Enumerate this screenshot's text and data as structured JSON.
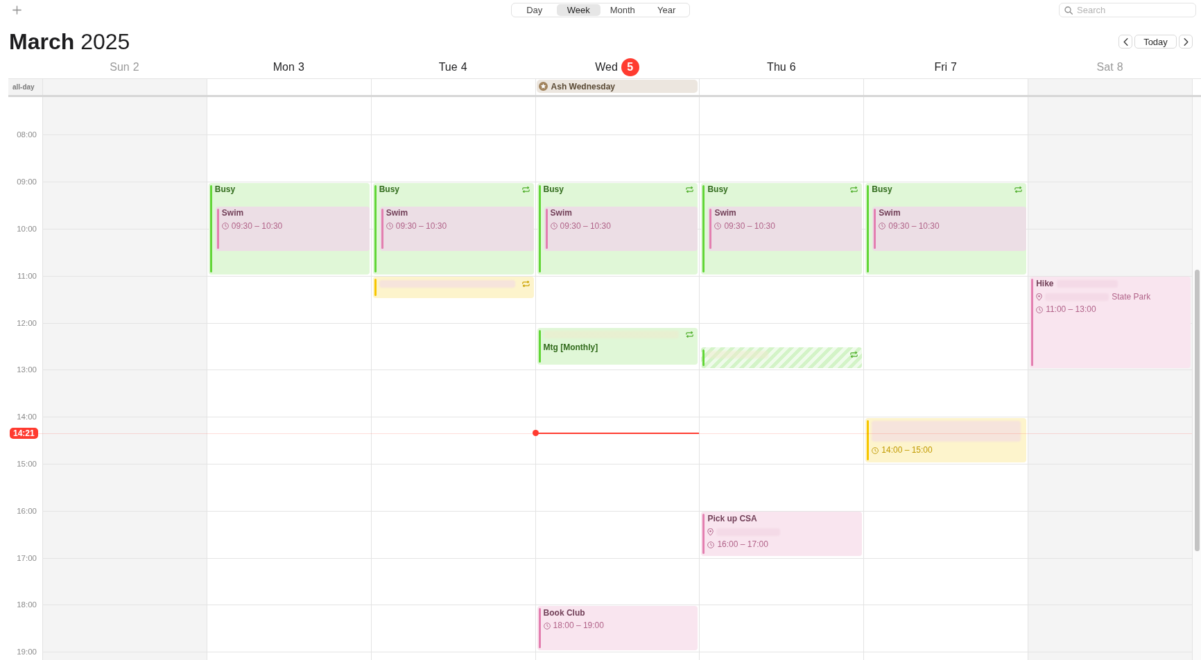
{
  "toolbar": {
    "views": [
      {
        "label": "Day",
        "selected": false
      },
      {
        "label": "Week",
        "selected": true
      },
      {
        "label": "Month",
        "selected": false
      },
      {
        "label": "Year",
        "selected": false
      }
    ],
    "search": {
      "placeholder": "Search"
    }
  },
  "header": {
    "title": "**March** 2025",
    "today_button": "Today"
  },
  "all_day_label": "all-day",
  "hours": [
    "08:00",
    "09:00",
    "10:00",
    "11:00",
    "12:00",
    "13:00",
    "14:00",
    "15:00",
    "16:00",
    "17:00",
    "18:00",
    "19:00"
  ],
  "now": {
    "label": "14:21"
  },
  "days": [
    {
      "weekday": "Sun",
      "date": "2",
      "weekend": true,
      "today": false
    },
    {
      "weekday": "Mon",
      "date": "3",
      "weekend": false,
      "today": false,
      "events": [
        {
          "kind": "plain",
          "title": "Busy",
          "color": "#62d637",
          "repeats": false,
          "tentative": false
        },
        {
          "kind": "plain",
          "title": "Swim",
          "time": "09:30 – 10:30",
          "color": "#e37fb0",
          "repeats": false,
          "tentative": false
        }
      ]
    },
    {
      "weekday": "Tue",
      "date": "4",
      "weekend": false,
      "today": false,
      "events": [
        {
          "kind": "plain",
          "title": "Busy",
          "color": "#62d637",
          "repeats": true,
          "tentative": false
        },
        {
          "kind": "plain",
          "title": "Swim",
          "time": "09:30 – 10:30",
          "color": "#e37fb0",
          "repeats": false,
          "tentative": false
        },
        {
          "kind": "masked",
          "color": "#f7c600",
          "repeats": true,
          "tentative": false
        }
      ]
    },
    {
      "weekday": "Wed",
      "date": "5",
      "weekend": false,
      "today": true,
      "all_day": [
        {
          "title": "Ash Wednesday",
          "color": "#a2845e"
        }
      ],
      "events": [
        {
          "kind": "plain",
          "title": "Busy",
          "color": "#62d637",
          "repeats": true,
          "tentative": false
        },
        {
          "kind": "plain",
          "title": "Swim",
          "time": "09:30 – 10:30",
          "color": "#e37fb0",
          "repeats": false,
          "tentative": false
        },
        {
          "kind": "masked",
          "title": "Mtg [Monthly]",
          "color": "#62d637",
          "repeats": true,
          "tentative": false
        },
        {
          "kind": "plain",
          "title": "Book Club",
          "time": "18:00 – 19:00",
          "color": "#e37fb0",
          "repeats": false,
          "tentative": false
        }
      ]
    },
    {
      "weekday": "Thu",
      "date": "6",
      "weekend": false,
      "today": false,
      "events": [
        {
          "kind": "plain",
          "title": "Busy",
          "color": "#62d637",
          "repeats": true,
          "tentative": false
        },
        {
          "kind": "plain",
          "title": "Swim",
          "time": "09:30 – 10:30",
          "color": "#e37fb0",
          "repeats": false,
          "tentative": false
        },
        {
          "kind": "partial",
          "color": "#62d637",
          "repeats": true,
          "tentative": true
        },
        {
          "kind": "plain",
          "title": "Pick up CSA",
          "location_blur": true,
          "time": "16:00 – 17:00",
          "color": "#e37fb0",
          "repeats": false,
          "tentative": false
        }
      ]
    },
    {
      "weekday": "Fri",
      "date": "7",
      "weekend": false,
      "today": false,
      "events": [
        {
          "kind": "plain",
          "title": "Busy",
          "color": "#62d637",
          "repeats": true,
          "tentative": false
        },
        {
          "kind": "plain",
          "title": "Swim",
          "time": "09:30 – 10:30",
          "color": "#e37fb0",
          "repeats": false,
          "tentative": false
        },
        {
          "kind": "obscured",
          "time": "14:00 – 15:00",
          "color": "#f7c600",
          "repeats": false,
          "tentative": false
        }
      ]
    },
    {
      "weekday": "Sat",
      "date": "8",
      "weekend": true,
      "today": false,
      "events": [
        {
          "kind": "partial",
          "title": "Hike",
          "location": "State Park",
          "location_blur": true,
          "time": "11:00 – 13:00",
          "color": "#e37fb0",
          "repeats": false,
          "tentative": false
        }
      ]
    }
  ]
}
